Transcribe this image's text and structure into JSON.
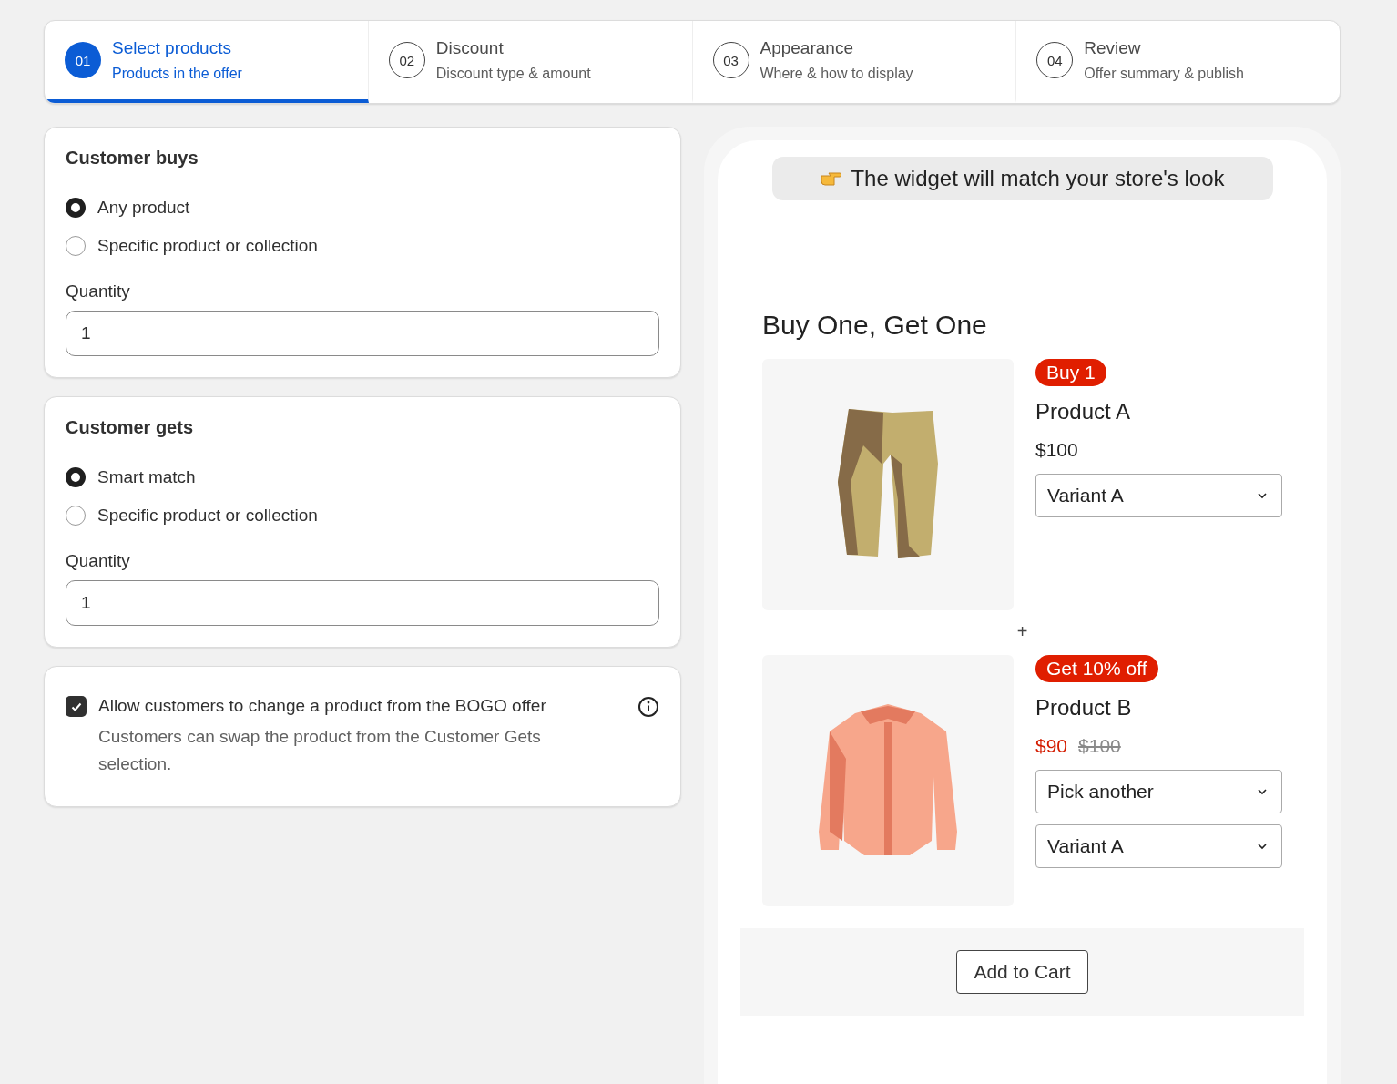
{
  "steps": [
    {
      "number": "01",
      "title": "Select products",
      "subtitle": "Products in the offer",
      "selected": true
    },
    {
      "number": "02",
      "title": "Discount",
      "subtitle": "Discount type & amount",
      "selected": false
    },
    {
      "number": "03",
      "title": "Appearance",
      "subtitle": "Where & how to display",
      "selected": false
    },
    {
      "number": "04",
      "title": "Review",
      "subtitle": "Offer summary & publish",
      "selected": false
    }
  ],
  "sections": [
    {
      "title": "Customer buys",
      "options": [
        {
          "label": "Any product",
          "selected": true
        },
        {
          "label": "Specific product or collection",
          "selected": false
        }
      ],
      "quantity": {
        "label": "Quantity",
        "value": "1"
      }
    },
    {
      "title": "Customer gets",
      "options": [
        {
          "label": "Smart match",
          "selected": true
        },
        {
          "label": "Specific product or collection",
          "selected": false
        }
      ],
      "quantity": {
        "label": "Quantity",
        "value": "1"
      }
    }
  ],
  "allow_change": {
    "label": "Allow customers to change a product from the BOGO offer",
    "description": "Customers can swap the product from the Customer Gets selection.",
    "checked": true
  },
  "preview": {
    "banner": "The widget will match your store's look",
    "title": "Buy One, Get One",
    "products": [
      {
        "kind": "shorts",
        "badge": "Buy 1",
        "name": "Product A",
        "price": "$100",
        "selects": [
          "Variant A"
        ]
      },
      {
        "kind": "shirt",
        "badge": "Get 10% off",
        "name": "Product B",
        "price": "$90",
        "original_price": "$100",
        "selects": [
          "Pick another",
          "Variant A"
        ]
      }
    ],
    "separator": "+",
    "add_to_cart": "Add to Cart"
  }
}
